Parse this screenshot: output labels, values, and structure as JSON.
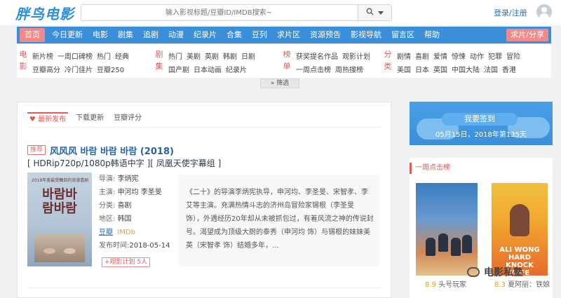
{
  "site": {
    "logo": "胖鸟电影"
  },
  "search": {
    "placeholder": "输入影视标题/豆瓣ID/IMDB搜索~"
  },
  "header": {
    "login_label": "登录/注册"
  },
  "nav": {
    "items": [
      "首页",
      "今日更新",
      "电影",
      "剧集",
      "追剧",
      "动漫",
      "纪录片",
      "合集",
      "豆列",
      "求片区",
      "资源预告",
      "影视导航",
      "留言区",
      "帮助"
    ],
    "request_label": "求片/分享"
  },
  "filters": {
    "movie": {
      "label": "电影",
      "row1": [
        "新片榜",
        "一周口碑榜",
        "热门",
        "经典"
      ],
      "row2": [
        "豆瓣高分",
        "冷门佳片",
        "豆瓣250"
      ]
    },
    "series": {
      "label": "剧集",
      "row1": [
        "热门",
        "美剧",
        "英剧",
        "韩剧",
        "日剧"
      ],
      "row2": [
        "国产剧",
        "日本动画",
        "纪录片"
      ]
    },
    "rank": {
      "label": "榜单",
      "row1": [
        "获奖提名作品",
        "观影计划"
      ],
      "row2": [
        "一周点击榜",
        "周热搜榜"
      ]
    },
    "category": {
      "label": "分类",
      "row1": [
        "剧情",
        "喜剧",
        "爱情",
        "惊悚",
        "动作",
        "犯罪",
        "冒险"
      ],
      "row2": [
        "美国",
        "日本",
        "英国",
        "中国大陆",
        "法国",
        "香港"
      ]
    },
    "expand_label": "» 筛选"
  },
  "tabs": [
    "♥ 最新发布",
    "下载更新",
    "豆瓣评分"
  ],
  "movie": {
    "badge": "推荐",
    "title": "风风风  바람 바람 바람 (2018)",
    "subtitle": "[ HDRip720p/1080p韩语中字 ][ 凤凰天使字幕组 ]",
    "poster_top": "2018年度最受瞩目的浪漫喜剧",
    "poster_title": "바람바람바람",
    "director_label": "导演:",
    "director": "李炳宪",
    "cast_label": "主演:",
    "cast": "申河均  李圣旻",
    "genre_label": "分类:",
    "genre": "喜剧",
    "region_label": "地区:",
    "region": "韩国",
    "douban": "豆瓣",
    "imdb": "IMDb",
    "date_label": "发布时间:",
    "date": "2018-05-14",
    "favorite": "+观影计划 5人",
    "description": "《二十》的导演李炳宪执导，申河均、李圣旻、宋智孝、李艾等主演。充满热情斗志的济州岛冒险家锡根（李圣旻 饰），外遇经历20年却从未被抓包过，有着风流之神的传说封号。渴望成为顶级大厨的泰秀（申河均 饰）与锡根的妹妹美英（宋智孝 饰）结婚多年，..."
  },
  "sidebar": {
    "signin_label": "我要签到",
    "signin_date": "05月15日，2018年第135天",
    "weekly_title": "一周点击榜",
    "items": [
      {
        "score": "8.9",
        "title": "头号玩家"
      },
      {
        "score": "8.3",
        "title": "夏阿丽：铁娘"
      }
    ]
  },
  "watermark": "电影私塾"
}
